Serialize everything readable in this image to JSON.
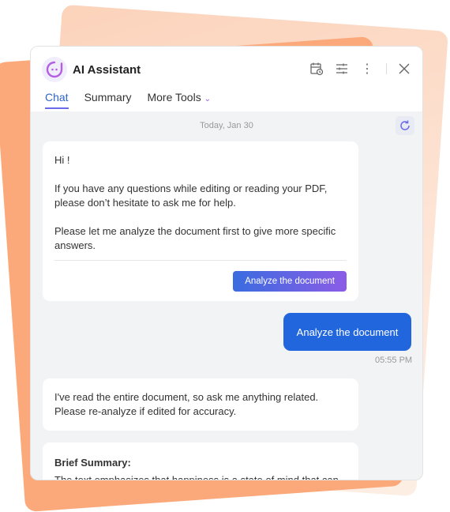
{
  "header": {
    "title": "AI Assistant"
  },
  "tabs": [
    {
      "label": "Chat"
    },
    {
      "label": "Summary"
    },
    {
      "label": "More Tools"
    }
  ],
  "chat": {
    "date": "Today, Jan 30",
    "welcome": {
      "greeting": "Hi !",
      "line1": "If you have any questions while editing or reading your PDF, please don’t hesitate to ask me for help.",
      "line2": "Please let me analyze the document first to give more specific answers.",
      "button": "Analyze the document"
    },
    "user_message": "Analyze the document",
    "user_time": "05:55 PM",
    "reply": "I've read the entire document, so ask me anything related. Please re-analyze if edited for accuracy.",
    "summary_title": "Brief Summary:",
    "summary_text": "The text emphasizes that happiness is a state of mind that can"
  },
  "colors": {
    "accent": "#2266dd",
    "tab_active": "#2f64c8",
    "background_deco": "#fba97a"
  }
}
